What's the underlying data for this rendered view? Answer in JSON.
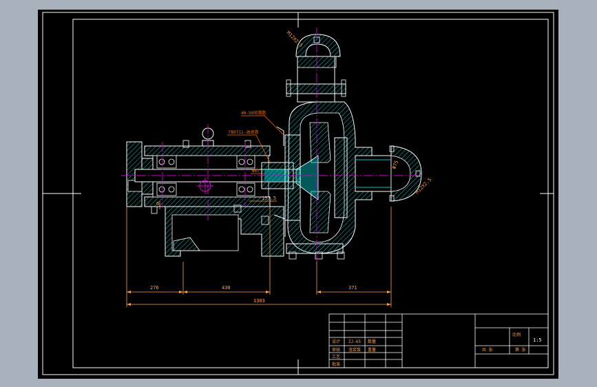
{
  "drawing": {
    "dims": {
      "d_left": "276",
      "d_mid": "430",
      "d_right": "371",
      "d_total": "1303",
      "d_shaft": "157.5",
      "d_small": "6"
    },
    "flange_labels": {
      "top_flange": "M12X2.5",
      "right_flange": "M12X2.5",
      "bore": "Φ75"
    },
    "annotations": {
      "seal_note": "40-50润滑脂",
      "bearing_note": "FB0711-油润滑",
      "shaft_note": "Φ67"
    },
    "title_block": {
      "scale_label": "比例",
      "scale_value": "1:5",
      "sheet_label": "共 张",
      "sheet_of": "第 张",
      "design": "设计",
      "check": "审核",
      "approve": "批准",
      "process": "工艺",
      "qty_label": "数量",
      "weight_label": "重量",
      "part_name": "渣浆泵",
      "part_no": "ZJ-65"
    }
  },
  "colors": {
    "background": "#000000",
    "frame": "#ffffff",
    "hatch": "#00c8c8",
    "center_line": "#d000d0",
    "dimension": "#ffa040",
    "annotation": "#ff6a00"
  }
}
